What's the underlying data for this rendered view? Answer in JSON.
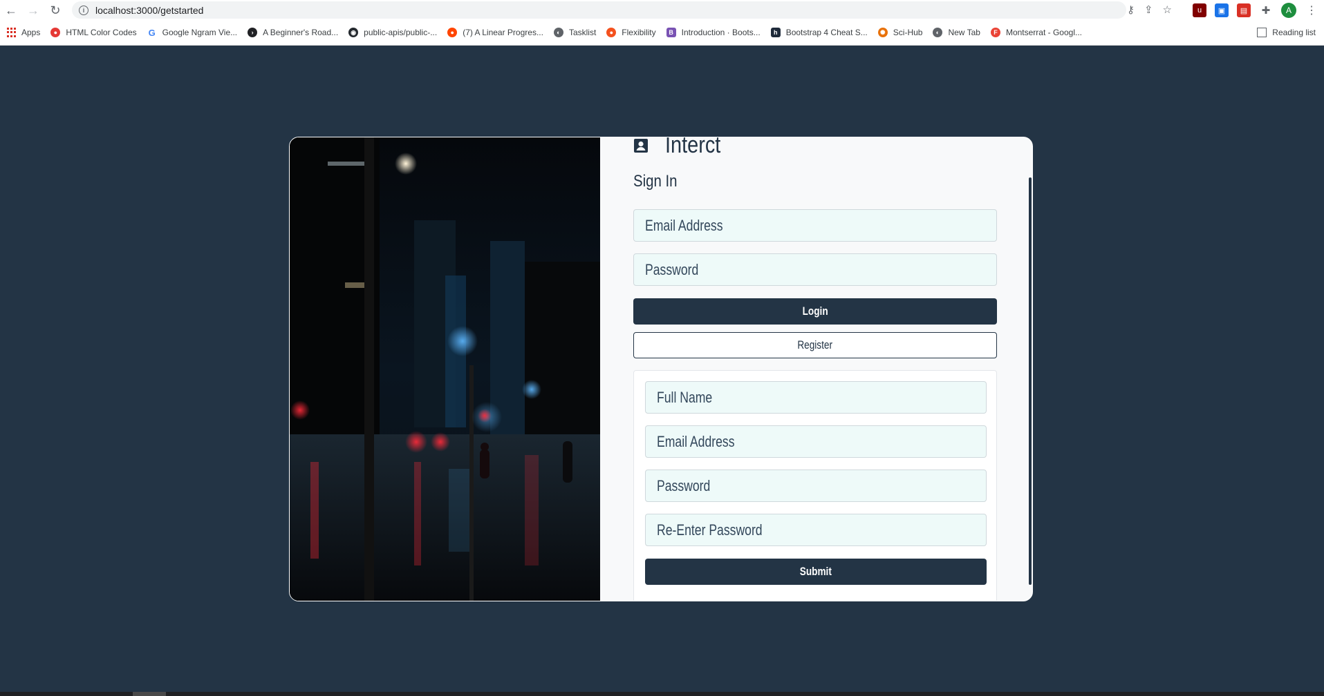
{
  "browser": {
    "url": "localhost:3000/getstarted",
    "bookmarks": [
      {
        "label": "Apps",
        "color": "#d93025"
      },
      {
        "label": "HTML Color Codes",
        "color": "#e53935"
      },
      {
        "label": "Google Ngram Vie...",
        "color": "#4285f4"
      },
      {
        "label": "A Beginner's Road...",
        "color": "#202124"
      },
      {
        "label": "public-apis/public-...",
        "color": "#24292e"
      },
      {
        "label": "(7) A Linear Progres...",
        "color": "#ff4500"
      },
      {
        "label": "Tasklist",
        "color": "#5f6368"
      },
      {
        "label": "Flexibility",
        "color": "#f4511e"
      },
      {
        "label": "Introduction · Boots...",
        "color": "#7952b3"
      },
      {
        "label": "Bootstrap 4 Cheat S...",
        "color": "#1e2a3a"
      },
      {
        "label": "Sci-Hub",
        "color": "#e8710a"
      },
      {
        "label": "New Tab",
        "color": "#5f6368"
      },
      {
        "label": "Montserrat - Googl...",
        "color": "#ea4335"
      }
    ],
    "reading_list": "Reading list",
    "avatar_letter": "A"
  },
  "app": {
    "brand": "Interct",
    "signin_heading": "Sign In",
    "login_form": {
      "email_placeholder": "Email Address",
      "password_placeholder": "Password",
      "login_label": "Login",
      "register_label": "Register"
    },
    "register_form": {
      "fullname_placeholder": "Full Name",
      "email_placeholder": "Email Address",
      "password_placeholder": "Password",
      "repassword_placeholder": "Re-Enter Password",
      "submit_label": "Submit"
    },
    "colors": {
      "background": "#233445",
      "accent": "#233445",
      "input_bg": "#eefaf9"
    }
  }
}
